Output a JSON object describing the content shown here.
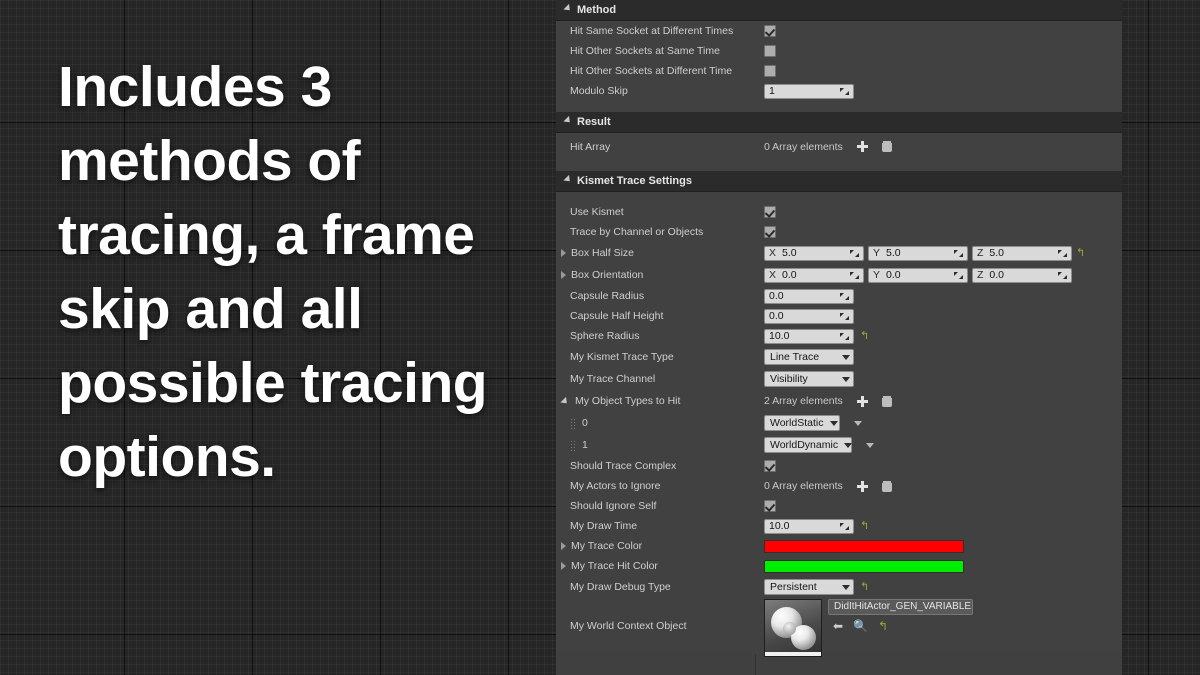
{
  "overlay": {
    "headline": "Includes 3 methods of tracing, a frame skip and all possible tracing options."
  },
  "panel": {
    "sections": [
      {
        "title": "Method",
        "rows": [
          {
            "label": "Hit Same Socket at Different Times",
            "type": "checkbox",
            "value": "checked"
          },
          {
            "label": "Hit Other Sockets at Same Time",
            "type": "checkbox",
            "value": "unchecked"
          },
          {
            "label": "Hit Other Sockets at Different Time",
            "type": "checkbox",
            "value": "unchecked"
          },
          {
            "label": "Modulo Skip",
            "type": "number",
            "value": "1"
          }
        ]
      },
      {
        "title": "Result",
        "rows": [
          {
            "label": "Hit Array",
            "type": "array",
            "value": "0 Array elements"
          }
        ]
      },
      {
        "title": "Kismet Trace Settings",
        "rows": [
          {
            "label": "Use Kismet",
            "type": "checkbox",
            "value": "checked"
          },
          {
            "label": "Trace by Channel or Objects",
            "type": "checkbox",
            "value": "checked"
          },
          {
            "label": "Box Half Size",
            "type": "vector",
            "axis_x": "X",
            "x": "5.0",
            "axis_y": "Y",
            "y": "5.0",
            "axis_z": "Z",
            "z": "5.0"
          },
          {
            "label": "Box Orientation",
            "type": "vector",
            "axis_x": "X",
            "x": "0.0",
            "axis_y": "Y",
            "y": "0.0",
            "axis_z": "Z",
            "z": "0.0"
          },
          {
            "label": "Capsule Radius",
            "type": "number",
            "value": "0.0"
          },
          {
            "label": "Capsule Half Height",
            "type": "number",
            "value": "0.0"
          },
          {
            "label": "Sphere Radius",
            "type": "number",
            "value": "10.0"
          },
          {
            "label": "My Kismet Trace Type",
            "type": "combo",
            "value": "Line Trace"
          },
          {
            "label": "My Trace Channel",
            "type": "combo",
            "value": "Visibility"
          },
          {
            "label": "My Object Types to Hit",
            "type": "array",
            "value": "2 Array elements"
          },
          {
            "label": "0",
            "type": "array-item-combo",
            "value": "WorldStatic"
          },
          {
            "label": "1",
            "type": "array-item-combo",
            "value": "WorldDynamic"
          },
          {
            "label": "Should Trace Complex",
            "type": "checkbox",
            "value": "checked"
          },
          {
            "label": "My Actors to Ignore",
            "type": "array",
            "value": "0 Array elements"
          },
          {
            "label": "Should Ignore Self",
            "type": "checkbox",
            "value": "checked"
          },
          {
            "label": "My Draw Time",
            "type": "number",
            "value": "10.0"
          },
          {
            "label": "My Trace Color",
            "type": "color",
            "value": "#FF0000"
          },
          {
            "label": "My Trace Hit Color",
            "type": "color",
            "value": "#00EE00"
          },
          {
            "label": "My Draw Debug Type",
            "type": "combo",
            "value": "Persistent"
          },
          {
            "label": "My World Context Object",
            "type": "object",
            "value": "DidItHitActor_GEN_VARIABLE"
          }
        ]
      }
    ]
  },
  "colors": {
    "trace": "#FF0000",
    "trace_hit": "#00EE00",
    "panel_bg": "#404040",
    "category_bg": "#2b2b2b",
    "revert": "#a8a035"
  }
}
